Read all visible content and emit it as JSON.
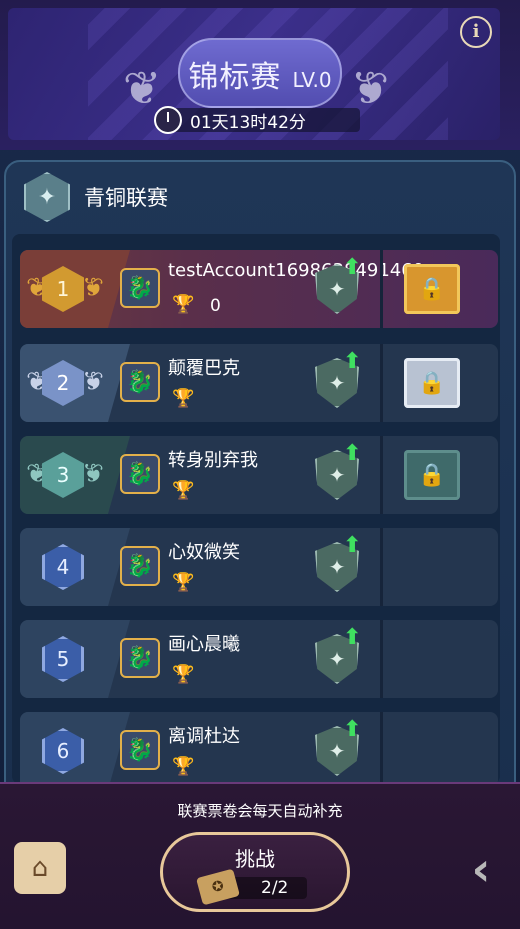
{
  "header": {
    "title": "锦标赛",
    "level": "LV.0",
    "timer": "01天13时42分",
    "info_icon": "info-icon"
  },
  "league": {
    "name": "青铜联赛",
    "badge_icon": "dragon-badge-icon"
  },
  "rows": [
    {
      "rank": "1",
      "name": "testAccount1698638491460",
      "score": "0",
      "tier": "gold",
      "chest": "gold"
    },
    {
      "rank": "2",
      "name": "颠覆巴克",
      "score": "",
      "tier": "silver",
      "chest": "silver"
    },
    {
      "rank": "3",
      "name": "转身别弃我",
      "score": "",
      "tier": "bronze",
      "chest": "bronze"
    },
    {
      "rank": "4",
      "name": "心奴微笑",
      "score": "",
      "tier": "plain",
      "chest": ""
    },
    {
      "rank": "5",
      "name": "画心晨曦",
      "score": "",
      "tier": "plain",
      "chest": ""
    },
    {
      "rank": "6",
      "name": "离调杜达",
      "score": "",
      "tier": "plain",
      "chest": ""
    }
  ],
  "bottom": {
    "notice": "联赛票卷会每天自动补充",
    "challenge_label": "挑战",
    "tickets": "2/2",
    "shop_icon": "shop-icon",
    "back_icon": "back-arrow-icon"
  }
}
